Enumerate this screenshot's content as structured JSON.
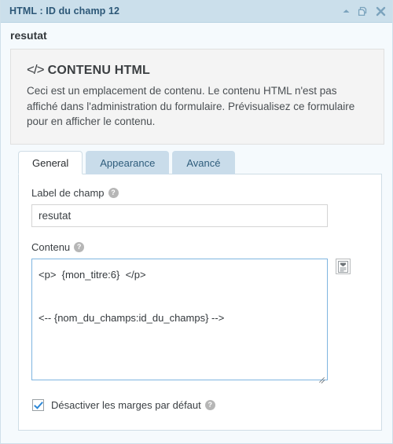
{
  "window": {
    "title": "HTML : ID du champ 12",
    "icons": {
      "collapse": "caret-up-icon",
      "duplicate": "duplicate-icon",
      "close": "close-icon"
    }
  },
  "field": {
    "title": "resutat"
  },
  "notice": {
    "code_glyph": "</>",
    "heading": "CONTENU HTML",
    "body": "Ceci est un emplacement de contenu. Le contenu HTML n'est pas affiché dans l'administration du formulaire. Prévisualisez ce formulaire pour en afficher le contenu."
  },
  "tabs": [
    {
      "label": "General",
      "active": true
    },
    {
      "label": "Appearance",
      "active": false
    },
    {
      "label": "Avancé",
      "active": false
    }
  ],
  "form": {
    "label_field": {
      "label": "Label de champ",
      "help": "?",
      "value": "resutat",
      "placeholder": ""
    },
    "content_field": {
      "label": "Contenu",
      "help": "?",
      "value": "<p>  {mon_titre:6}  </p>\n\n<-- {nom_du_champs:id_du_champs} -->",
      "placeholder": "",
      "merge_tag_button": "insert-merge-tag-icon"
    },
    "disable_margins": {
      "label": "Désactiver les marges par défaut",
      "help": "?",
      "checked": true
    }
  },
  "colors": {
    "titlebar": "#cbdfeb",
    "title_text": "#2c5777",
    "panel_bg": "#f5fafd",
    "tab_inactive": "#c9dcea",
    "tab_active": "#ffffff",
    "focus_border": "#7fb5e0",
    "checkmark": "#2d87d6"
  }
}
